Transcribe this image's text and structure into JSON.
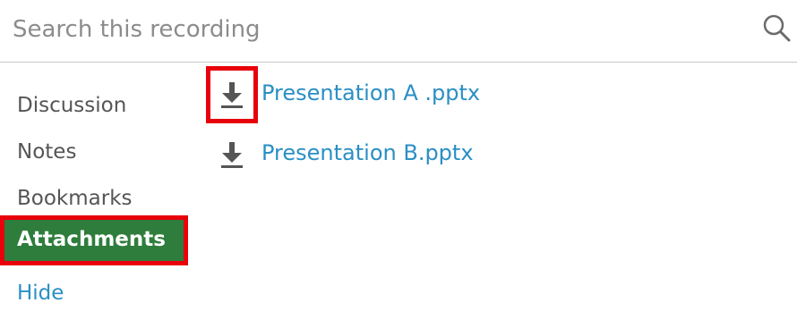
{
  "search": {
    "placeholder": "Search this recording",
    "value": "",
    "icon": "search-icon"
  },
  "sidebar": {
    "items": [
      {
        "label": "Discussion",
        "active": false
      },
      {
        "label": "Notes",
        "active": false
      },
      {
        "label": "Bookmarks",
        "active": false
      },
      {
        "label": "Attachments",
        "active": true
      },
      {
        "label": "Hide",
        "active": false,
        "link": true
      }
    ],
    "active_color": "#2e7d3c",
    "highlight_color": "#e8000b"
  },
  "attachments": {
    "items": [
      {
        "name": "Presentation A .pptx",
        "icon": "download-icon",
        "highlighted": true
      },
      {
        "name": "Presentation B.pptx",
        "icon": "download-icon",
        "highlighted": false
      }
    ],
    "link_color": "#2a8fc4"
  }
}
